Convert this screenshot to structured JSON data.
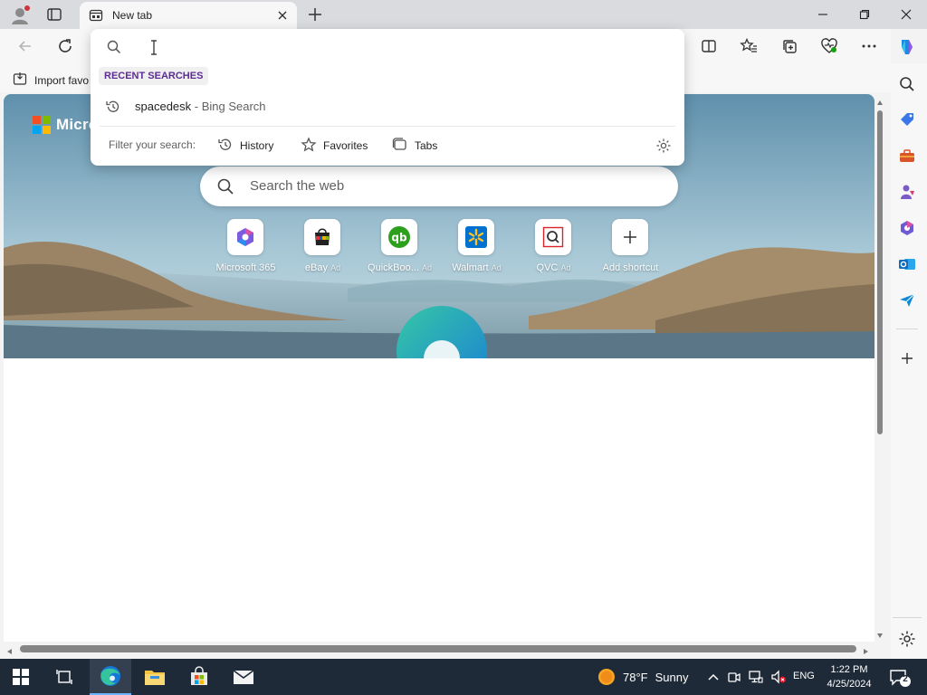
{
  "browser": {
    "tab": {
      "title": "New tab"
    },
    "favorites_bar": {
      "import_label": "Import favo"
    }
  },
  "address_dropdown": {
    "section_label": "RECENT SEARCHES",
    "recent": [
      {
        "query": "spacedesk",
        "source": " - Bing Search"
      }
    ],
    "filter_label": "Filter your search:",
    "filters": [
      {
        "label": "History",
        "icon": "history-icon"
      },
      {
        "label": "Favorites",
        "icon": "star-icon"
      },
      {
        "label": "Tabs",
        "icon": "tabs-icon"
      }
    ]
  },
  "new_tab_page": {
    "logo_text": "Micro",
    "search_placeholder": "Search the web",
    "shortcuts": [
      {
        "label": "Microsoft 365",
        "ad": ""
      },
      {
        "label": "eBay",
        "ad": "Ad"
      },
      {
        "label": "QuickBoo...",
        "ad": "Ad"
      },
      {
        "label": "Walmart",
        "ad": "Ad"
      },
      {
        "label": "QVC",
        "ad": "Ad"
      },
      {
        "label": "Add shortcut",
        "ad": ""
      }
    ]
  },
  "taskbar": {
    "weather": {
      "temp": "78°F",
      "condition": "Sunny"
    },
    "language": "ENG",
    "time": "1:22 PM",
    "date": "4/25/2024",
    "notifications": "2"
  },
  "colors": {
    "accent": "#5c2d91",
    "taskbar": "#1f2a38",
    "page_bg": "#f3f3f3"
  }
}
